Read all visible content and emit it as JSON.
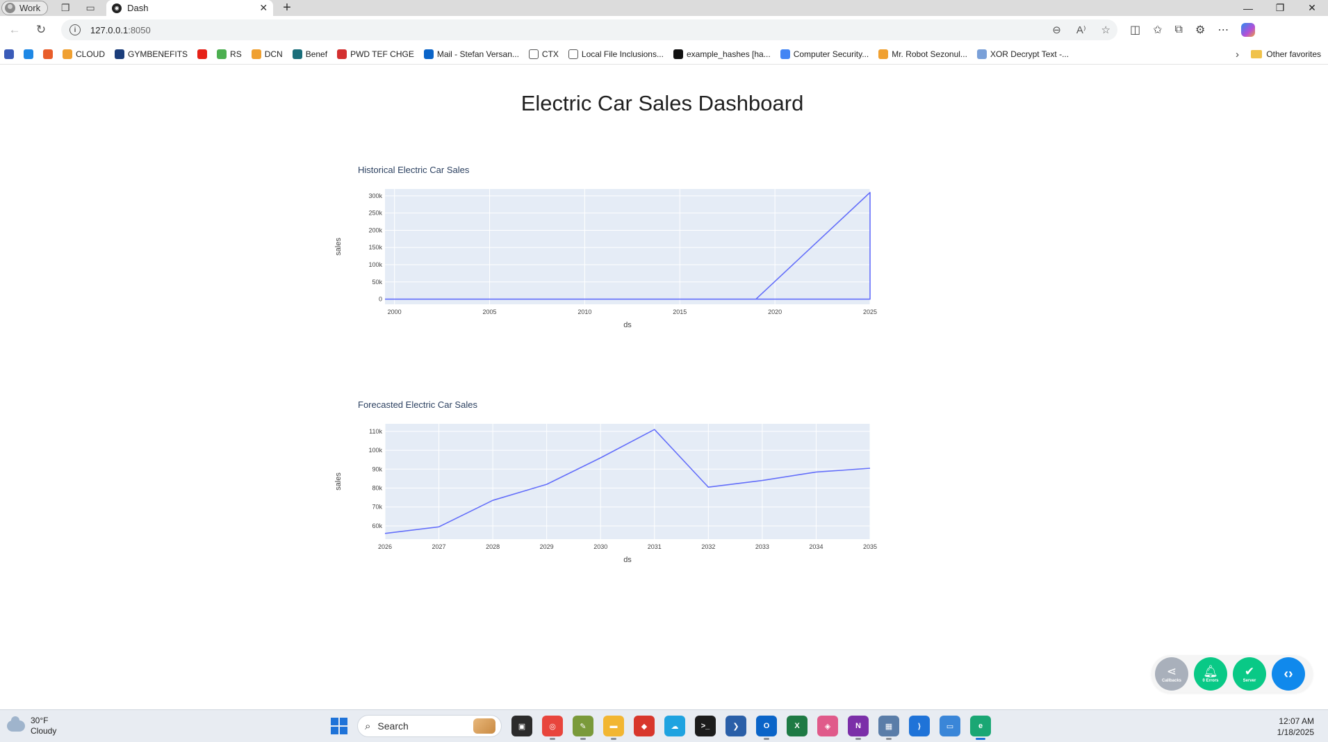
{
  "browser": {
    "profile": "Work",
    "tab_title": "Dash",
    "url_host": "127.0.0.1",
    "url_port": ":8050",
    "favorites": [
      {
        "label": "",
        "color": "#3a5bb8"
      },
      {
        "label": "",
        "color": "#1e88e5"
      },
      {
        "label": "",
        "color": "#e85d2a"
      },
      {
        "label": "CLOUD",
        "color": "#f0a030"
      },
      {
        "label": "GYMBENEFITS",
        "color": "#1b3d7a"
      },
      {
        "label": "",
        "color": "#e62117"
      },
      {
        "label": "RS",
        "color": "#4caf50"
      },
      {
        "label": "DCN",
        "color": "#f0a030"
      },
      {
        "label": "Benef",
        "color": "#1a6e7a"
      },
      {
        "label": "PWD TEF CHGE",
        "color": "#d32f2f"
      },
      {
        "label": "Mail - Stefan Versan...",
        "color": "#0a64c8"
      },
      {
        "label": "CTX",
        "color": "#ffffff"
      },
      {
        "label": "Local File Inclusions...",
        "color": "#ffffff"
      },
      {
        "label": "example_hashes [ha...",
        "color": "#111111"
      },
      {
        "label": "Computer Security...",
        "color": "#4285f4"
      },
      {
        "label": "Mr. Robot Sezonul...",
        "color": "#f0a030"
      },
      {
        "label": "XOR Decrypt Text -...",
        "color": "#7aa0d8"
      }
    ],
    "other_favorites": "Other favorites"
  },
  "page": {
    "title": "Electric Car Sales Dashboard"
  },
  "chart_data": [
    {
      "type": "line",
      "title": "Historical Electric Car Sales",
      "xlabel": "ds",
      "ylabel": "sales",
      "xlim": [
        1999.5,
        2025
      ],
      "ylim": [
        -15000,
        320000
      ],
      "x_ticks": [
        2000,
        2005,
        2010,
        2015,
        2020,
        2025
      ],
      "x_tick_labels": [
        "2000",
        "2005",
        "2010",
        "2015",
        "2020",
        "2025"
      ],
      "y_ticks": [
        0,
        50000,
        100000,
        150000,
        200000,
        250000,
        300000
      ],
      "y_tick_labels": [
        "0",
        "50k",
        "100k",
        "150k",
        "200k",
        "250k",
        "300k"
      ],
      "color": "#636efa",
      "grid": true,
      "series": [
        {
          "x": [
            1999.5,
            2019,
            2025,
            2025,
            1999.5
          ],
          "y": [
            0,
            0,
            310000,
            0,
            0
          ]
        }
      ]
    },
    {
      "type": "line",
      "title": "Forecasted Electric Car Sales",
      "xlabel": "ds",
      "ylabel": "sales",
      "xlim": [
        2026,
        2035
      ],
      "ylim": [
        53000,
        114000
      ],
      "x_ticks": [
        2026,
        2027,
        2028,
        2029,
        2030,
        2031,
        2032,
        2033,
        2034,
        2035
      ],
      "x_tick_labels": [
        "2026",
        "2027",
        "2028",
        "2029",
        "2030",
        "2031",
        "2032",
        "2033",
        "2034",
        "2035"
      ],
      "y_ticks": [
        60000,
        70000,
        80000,
        90000,
        100000,
        110000
      ],
      "y_tick_labels": [
        "60k",
        "70k",
        "80k",
        "90k",
        "100k",
        "110k"
      ],
      "color": "#636efa",
      "grid": true,
      "series": [
        {
          "x": [
            2026,
            2027,
            2028,
            2029,
            2030,
            2031,
            2032,
            2033,
            2034,
            2035
          ],
          "y": [
            56000,
            59500,
            73500,
            82000,
            96000,
            111000,
            80500,
            84000,
            88500,
            90500
          ]
        }
      ]
    }
  ],
  "devtools": {
    "callbacks": "Callbacks",
    "errors": "0 Errors",
    "server": "Server"
  },
  "taskbar": {
    "temperature": "30°F",
    "condition": "Cloudy",
    "search": "Search",
    "time": "12:07 AM",
    "date": "1/18/2025"
  }
}
